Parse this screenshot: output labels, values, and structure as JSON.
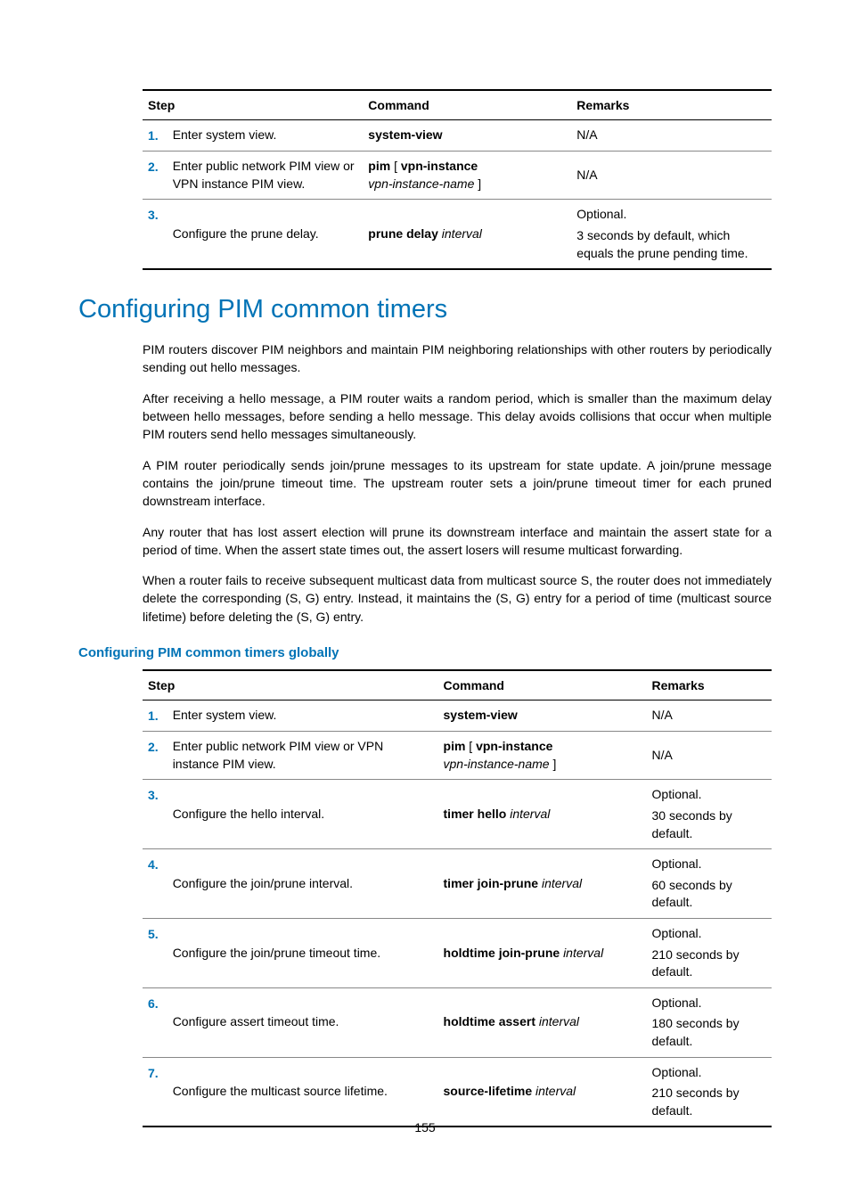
{
  "page_number": "155",
  "table1": {
    "header": {
      "step": "Step",
      "command": "Command",
      "remarks": "Remarks"
    },
    "rows": [
      {
        "num": "1.",
        "desc": "Enter system view.",
        "cmd_bold": "system-view",
        "cmd_tail": "",
        "remarks": "N/A"
      },
      {
        "num": "2.",
        "desc": "Enter public network PIM view or VPN instance PIM view.",
        "cmd_bold": "pim",
        "cmd_mid_plain": " [ ",
        "cmd_bold2": "vpn-instance",
        "cmd_ital": "vpn-instance-name",
        "cmd_tail": " ]",
        "remarks": "N/A"
      },
      {
        "num": "3.",
        "desc": "Configure the prune delay.",
        "cmd_bold": "prune delay",
        "cmd_space": " ",
        "cmd_ital": "interval",
        "remarks_l1": "Optional.",
        "remarks_l2": "3 seconds by default, which equals the prune pending time."
      }
    ]
  },
  "section_title": "Configuring PIM common timers",
  "paragraphs": [
    "PIM routers discover PIM neighbors and maintain PIM neighboring relationships with other routers by periodically sending out hello messages.",
    "After receiving a hello message, a PIM router waits a random period, which is smaller than the maximum delay between hello messages, before sending a hello message. This delay avoids collisions that occur when multiple PIM routers send hello messages simultaneously.",
    "A PIM router periodically sends join/prune messages to its upstream for state update. A join/prune message contains the join/prune timeout time. The upstream router sets a join/prune timeout timer for each pruned downstream interface.",
    "Any router that has lost assert election will prune its downstream interface and maintain the assert state for a period of time. When the assert state times out, the assert losers will resume multicast forwarding.",
    "When a router fails to receive subsequent multicast data from multicast source S, the router does not immediately delete the corresponding (S, G) entry. Instead, it maintains the (S, G) entry for a period of time (multicast source lifetime) before deleting the (S, G) entry."
  ],
  "subsection_title": "Configuring PIM common timers globally",
  "table2": {
    "header": {
      "step": "Step",
      "command": "Command",
      "remarks": "Remarks"
    },
    "rows": [
      {
        "num": "1.",
        "desc": "Enter system view.",
        "cmd_bold": "system-view",
        "remarks": "N/A"
      },
      {
        "num": "2.",
        "desc": "Enter public network PIM view or VPN instance PIM view.",
        "cmd_bold": "pim",
        "cmd_mid_plain": " [ ",
        "cmd_bold2": "vpn-instance",
        "cmd_ital": "vpn-instance-name",
        "cmd_tail": " ]",
        "remarks": "N/A"
      },
      {
        "num": "3.",
        "desc": "Configure the hello interval.",
        "cmd_bold": "timer hello",
        "cmd_space": " ",
        "cmd_ital": "interval",
        "remarks_l1": "Optional.",
        "remarks_l2": "30 seconds by default."
      },
      {
        "num": "4.",
        "desc": "Configure the join/prune interval.",
        "cmd_bold": "timer join-prune",
        "cmd_space": " ",
        "cmd_ital": "interval",
        "remarks_l1": "Optional.",
        "remarks_l2": "60 seconds by default."
      },
      {
        "num": "5.",
        "desc": "Configure the join/prune timeout time.",
        "cmd_bold": "holdtime join-prune",
        "cmd_space": " ",
        "cmd_ital": "interval",
        "remarks_l1": "Optional.",
        "remarks_l2": "210 seconds by default."
      },
      {
        "num": "6.",
        "desc": "Configure assert timeout time.",
        "cmd_bold": "holdtime assert",
        "cmd_space": " ",
        "cmd_ital": "interval",
        "remarks_l1": "Optional.",
        "remarks_l2": "180 seconds by default."
      },
      {
        "num": "7.",
        "desc": "Configure the multicast source lifetime.",
        "cmd_bold": "source-lifetime",
        "cmd_space": " ",
        "cmd_ital": "interval",
        "remarks_l1": "Optional.",
        "remarks_l2": "210 seconds by default."
      }
    ]
  }
}
